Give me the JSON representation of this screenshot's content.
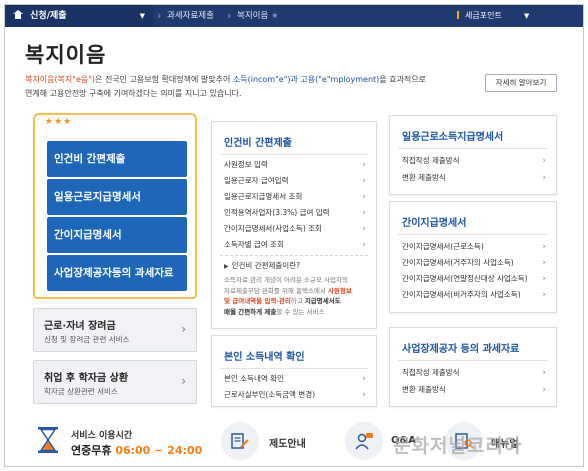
{
  "nav": {
    "menu_label": "신청/제출",
    "breadcrumb_1": "과세자료제출",
    "breadcrumb_2": "복지이음",
    "tax_point": "세금포인트"
  },
  "header": {
    "title": "복지이음",
    "desc_part1": "복지이음(복지\"e음\")",
    "desc_part2": "은 전국민 고용보험 확대정책에 발맞추어 ",
    "desc_part3": "소득(incom\"e\")과 고용(\"e\"mployment)",
    "desc_part4": "을 효과적으로",
    "desc_line2": "연계해 고용안전망 구축에 기여하겠다는 의미를 지니고 있습니다.",
    "more_button": "자세히 알아보기"
  },
  "left": {
    "stars": "★★★",
    "buttons": [
      "인건비 간편제출",
      "일용근로지급명세서",
      "간이지급명세서",
      "사업장제공자등의 과세자료"
    ],
    "card1_title": "근로·자녀 장려금",
    "card1_sub": "신청 및 장려금 관련 서비스",
    "card2_title": "취업 후 학자금 상환",
    "card2_sub": "학자금 상환관련 서비스"
  },
  "labor": {
    "title": "인건비 간편제출",
    "items": [
      "사원정보 입력",
      "일용근로자 급여입력",
      "일용근로지급명세서 조회",
      "인적용역사업자(3.3%) 급여 입력",
      "간이지급명세서(사업소득) 조회",
      "소득자별 급여 조회"
    ],
    "note_title": "인건비 간편제출이란?",
    "note_l1": "소득자료 관리 개념이 어려운 소규모 사업자의",
    "note_l2a": "자료제출부담 완화를 위해 홈택스에서 ",
    "note_l2b": "사원정보",
    "note_l3a": "및 급여내역을 입력·관리",
    "note_l3b": "하고 ",
    "note_l3c": "지급명세서도",
    "note_l4a": "매월 간편하게 제출",
    "note_l4b": "할 수 있는 서비스"
  },
  "income_check": {
    "title": "본인 소득내역 확인",
    "items": [
      "본인 소득내역 확인",
      "근로사실부인(소득금액 변경)"
    ]
  },
  "daily": {
    "title": "일용근로소득지급명세서",
    "items": [
      "직접작성 제출방식",
      "변환 제출방식"
    ]
  },
  "simple": {
    "title": "간이지급명세서",
    "items": [
      "간이지급명세서(근로소득)",
      "간이지급명세서(거주자의 사업소득)",
      "간이지급명세서(연말정산대상 사업소득)",
      "간이지급명세서(비거주자의 사업소득)"
    ]
  },
  "provider": {
    "title": "사업장제공자 등의 과세자료",
    "items": [
      "직접작성 제출방식",
      "변환 제출방식"
    ]
  },
  "bottom": {
    "service_label": "서비스 이용시간",
    "service_prefix": "연중무휴 ",
    "service_time": "06:00 ~ 24:00",
    "guide": "제도안내",
    "qa": "Q&A",
    "manual": "매뉴얼",
    "watermark": "문화저널코리아"
  },
  "colors": {
    "nav": "#1e3a6e",
    "primary": "#1d66b8",
    "accent_orange": "#f07f1a",
    "accent_red": "#d8451f",
    "border_gold": "#f5c04c"
  },
  "icons": {
    "home": "home-icon",
    "star": "star-icon",
    "chevron": "chevron-right-icon",
    "hourglass": "hourglass-icon",
    "guide": "document-pen-icon",
    "qa": "chat-person-icon",
    "manual": "book-magnifier-icon"
  }
}
